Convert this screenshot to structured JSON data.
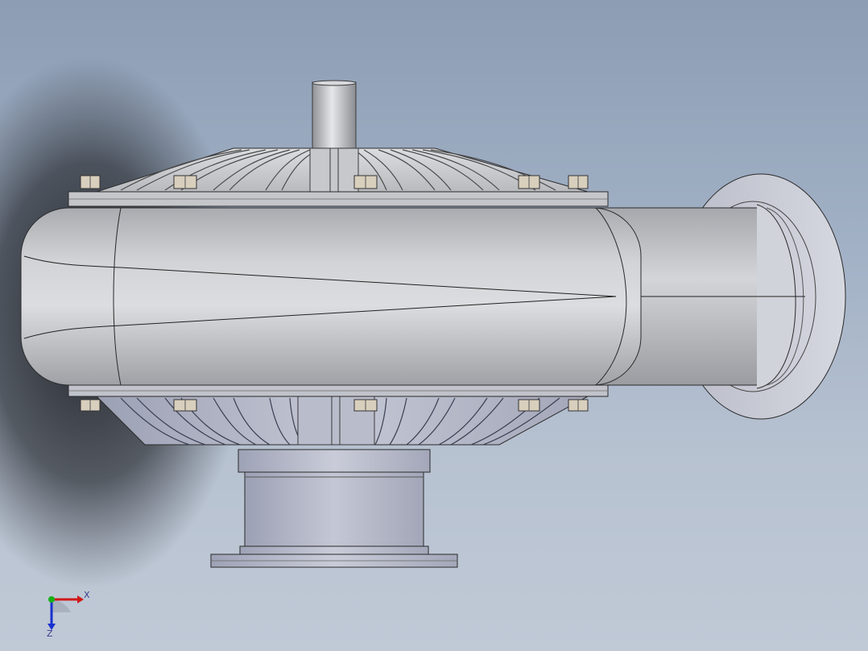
{
  "viewport": {
    "background_top": "#8c9db4",
    "background_bottom": "#c0c9d6"
  },
  "model": {
    "body_color": "#c9cbcf",
    "edge_color": "#1e1e1e",
    "bolt_color": "#d8cfbd",
    "flange_color": "#b4b8c9"
  },
  "triad": {
    "x_label": "X",
    "z_label": "Z",
    "x_color": "#d01818",
    "y_color": "#18b018",
    "z_color": "#1830d0"
  }
}
